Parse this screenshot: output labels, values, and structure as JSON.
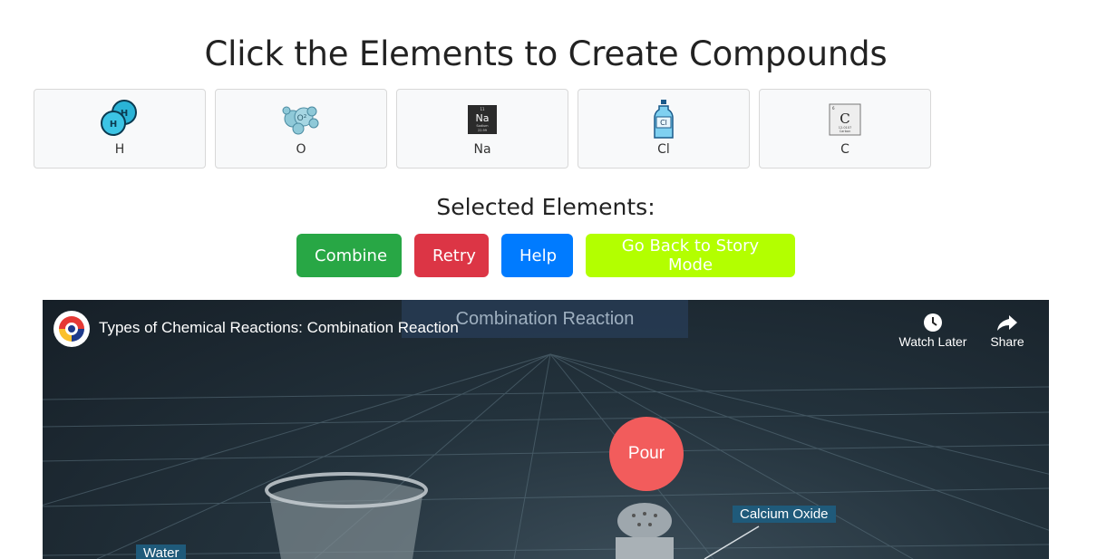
{
  "page": {
    "title": "Click the Elements to Create Compounds",
    "selected_label": "Selected Elements:"
  },
  "elements": [
    {
      "symbol": "H",
      "icon": "hydrogen-molecule-icon"
    },
    {
      "symbol": "O",
      "icon": "oxygen-molecule-icon"
    },
    {
      "symbol": "Na",
      "icon": "sodium-tile-icon"
    },
    {
      "symbol": "Cl",
      "icon": "chlorine-bottle-icon"
    },
    {
      "symbol": "C",
      "icon": "carbon-tile-icon"
    }
  ],
  "buttons": {
    "combine": "Combine",
    "retry": "Retry",
    "help": "Help",
    "story": "Go Back to Story Mode"
  },
  "video": {
    "title": "Types of Chemical Reactions: Combination Reaction",
    "banner": "Combination Reaction",
    "watch_later": "Watch Later",
    "share": "Share",
    "pour": "Pour",
    "label_calcium_oxide": "Calcium Oxide",
    "label_water": "Water"
  },
  "colors": {
    "combine": "#28a745",
    "retry": "#dc3545",
    "help": "#007bff",
    "story": "#b3ff00",
    "pour": "#f25c5c"
  }
}
